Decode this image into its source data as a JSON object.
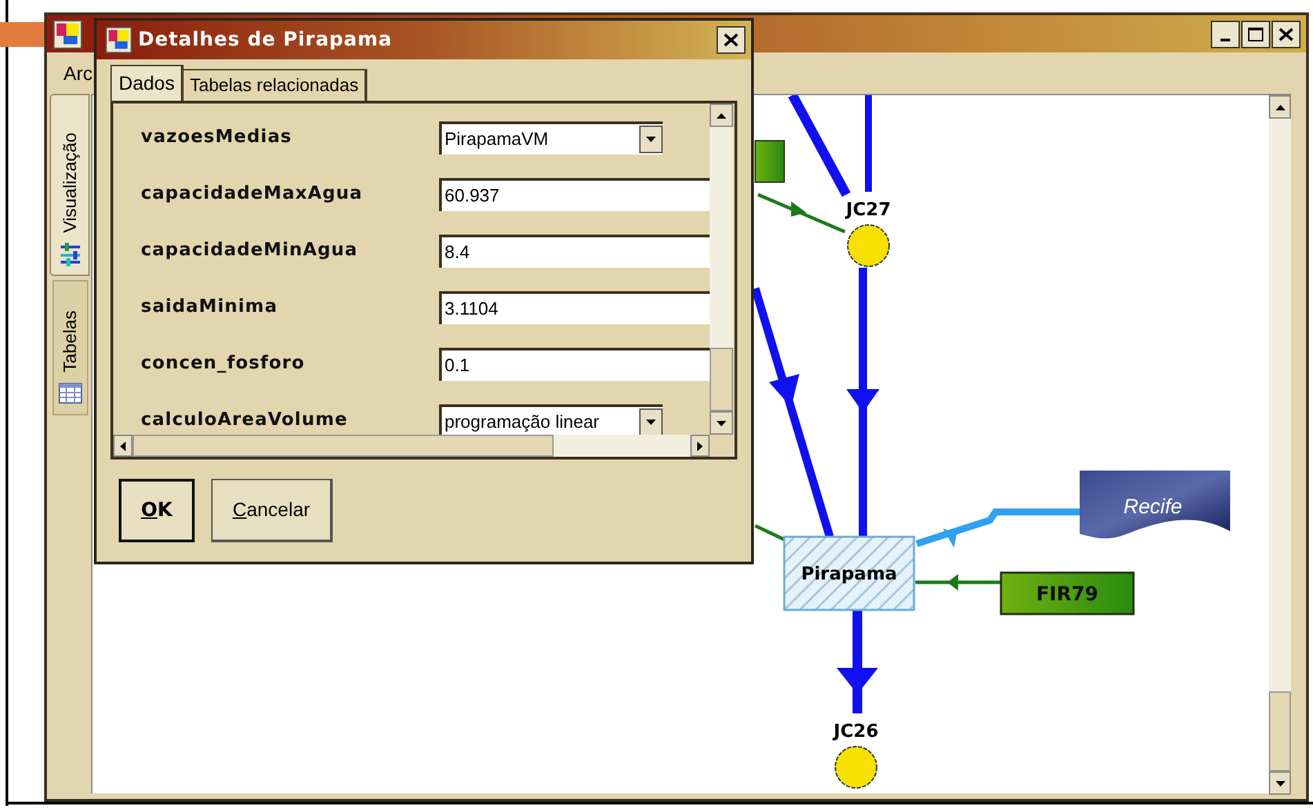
{
  "main_window": {
    "menu": [
      "Arc"
    ],
    "side_tabs": [
      {
        "label": "Visualização",
        "selected": true
      },
      {
        "label": "Tabelas",
        "selected": false
      }
    ],
    "diagram": {
      "nodes": [
        {
          "kind": "junction",
          "label": "JC27"
        },
        {
          "kind": "reservoir",
          "label": "Pirapama"
        },
        {
          "kind": "demand",
          "label": "Recife"
        },
        {
          "kind": "inflow",
          "label": "FIR79"
        },
        {
          "kind": "junction",
          "label": "JC26"
        }
      ]
    }
  },
  "dialog": {
    "title": "Detalhes de Pirapama",
    "tabs": [
      {
        "label": "Dados",
        "selected": true
      },
      {
        "label": "Tabelas relacionadas",
        "selected": false
      }
    ],
    "properties": [
      {
        "name": "vazoesMedias",
        "kind": "dropdown",
        "value": "PirapamaVM"
      },
      {
        "name": "capacidadeMaxAgua",
        "kind": "text",
        "value": "60.937"
      },
      {
        "name": "capacidadeMinAgua",
        "kind": "text",
        "value": "8.4"
      },
      {
        "name": "saidaMinima",
        "kind": "text",
        "value": "3.1104"
      },
      {
        "name": "concen_fosforo",
        "kind": "text",
        "value": "0.1"
      },
      {
        "name": "calculoAreaVolume",
        "kind": "dropdown",
        "value": "programação linear"
      }
    ],
    "buttons": [
      {
        "label": "OK",
        "default": true
      },
      {
        "label": "Cancelar",
        "default": false
      }
    ]
  }
}
